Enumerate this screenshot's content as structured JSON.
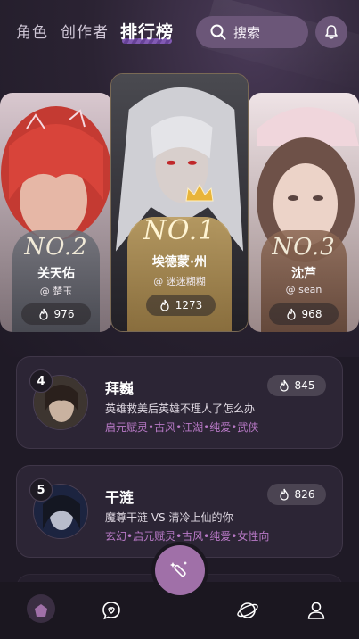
{
  "header": {
    "tabs": [
      {
        "label": "角色"
      },
      {
        "label": "创作者"
      },
      {
        "label": "排行榜"
      }
    ],
    "search_label": "搜索"
  },
  "podium": [
    {
      "rank_label": "NO.2",
      "name": "关天佑",
      "handle": "@ 楚玉",
      "heat": "976",
      "plaque_color": "#6e7078"
    },
    {
      "rank_label": "NO.1",
      "name": "埃德蒙·州",
      "handle": "@ 迷迷糊糊",
      "heat": "1273",
      "plaque_color": "#be9f64"
    },
    {
      "rank_label": "NO.3",
      "name": "沈芦",
      "handle": "@ sean",
      "heat": "968",
      "plaque_color": "#8c6854"
    }
  ],
  "ranking_list": [
    {
      "rank": "4",
      "title": "拜巍",
      "desc": "英雄救美后英雄不理人了怎么办",
      "tags": "启元赋灵•古风•江湖•纯爱•武侠",
      "heat": "845"
    },
    {
      "rank": "5",
      "title": "干涟",
      "desc": "魔尊干涟 VS 清冷上仙的你",
      "tags": "玄幻•启元赋灵•古风•纯爱•女性向",
      "heat": "826"
    }
  ],
  "colors": {
    "accent": "#a070a8",
    "tag": "#b879c6",
    "background": "#1f1a26"
  },
  "bottom_nav": {
    "items": [
      "home-icon",
      "chat-icon",
      "create-wand-icon",
      "planet-icon",
      "profile-icon"
    ]
  }
}
